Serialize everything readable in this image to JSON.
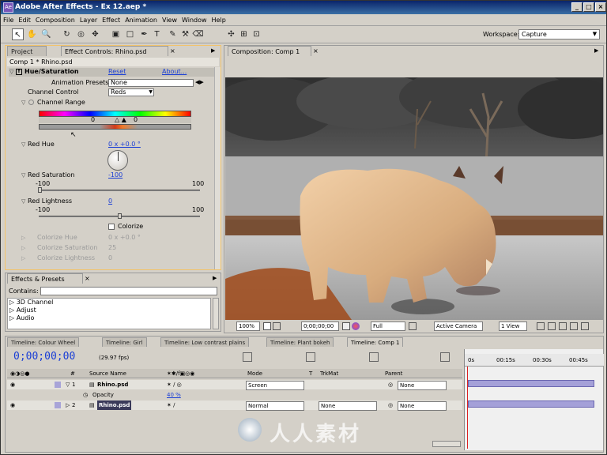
{
  "app": {
    "title": "Adobe After Effects - Ex 12.aep *",
    "icon_label": "Ae"
  },
  "window_controls": [
    "_",
    "□",
    "×"
  ],
  "menu": [
    "File",
    "Edit",
    "Composition",
    "Layer",
    "Effect",
    "Animation",
    "View",
    "Window",
    "Help"
  ],
  "tools": [
    "selection-tool",
    "hand-tool",
    "zoom-tool",
    "rotation-tool",
    "orbit-camera-tool",
    "track-xy-tool",
    "track-z-tool",
    "rectangle-mask-tool",
    "pen-tool",
    "type-tool",
    "brush-tool",
    "clone-stamp-tool",
    "eraser-tool",
    "axis-mode-local",
    "axis-mode-world",
    "axis-mode-view"
  ],
  "workspace": {
    "label": "Workspace:",
    "value": "Capture"
  },
  "left_panel": {
    "tabs": [
      "Project",
      "Effect Controls: Rhino.psd"
    ],
    "header": "Comp 1 * Rhino.psd",
    "effect": {
      "name": "Hue/Saturation",
      "reset": "Reset",
      "about": "About...",
      "presets_label": "Animation Presets:",
      "presets_value": "None",
      "channel_control_label": "Channel Control",
      "channel_control_value": "Reds",
      "channel_range_label": "Channel Range",
      "range_value": "0",
      "range_value2": "0",
      "red_hue_label": "Red Hue",
      "red_hue_value": "0 x +0.0 °",
      "red_saturation_label": "Red Saturation",
      "red_saturation_value": "-100",
      "sat_min": "-100",
      "sat_max": "100",
      "red_lightness_label": "Red Lightness",
      "red_lightness_value": "0",
      "light_min": "-100",
      "light_max": "100",
      "colorize_label": "Colorize",
      "colorize_hue_label": "Colorize Hue",
      "colorize_hue_value": "0 x +0.0 °",
      "colorize_saturation_label": "Colorize Saturation",
      "colorize_saturation_value": "25",
      "colorize_lightness_label": "Colorize Lightness",
      "colorize_lightness_value": "0"
    }
  },
  "effects_panel": {
    "tab": "Effects & Presets",
    "contains_label": "Contains:",
    "items": [
      "3D Channel",
      "Adjust",
      "Audio"
    ]
  },
  "comp_panel": {
    "tab": "Composition: Comp 1",
    "zoom": "100%",
    "timecode": "0;00;00;00",
    "resolution": "Full",
    "camera": "Active Camera",
    "views": "1 View"
  },
  "timeline": {
    "tabs": [
      "Timeline: Colour Wheel",
      "Timeline: Girl",
      "Timeline: Low contrast plains",
      "Timeline: Plant bokeh",
      "Timeline: Comp 1"
    ],
    "timecode": "0;00;00;00",
    "fps": "(29.97 fps)",
    "columns": {
      "num": "#",
      "source": "Source Name",
      "mode": "Mode",
      "t": "T",
      "trkmat": "TrkMat",
      "parent": "Parent"
    },
    "ruler": [
      "0s",
      "00:15s",
      "00:30s",
      "00:45s"
    ],
    "layers": [
      {
        "num": "1",
        "name": "Rhino.psd",
        "mode": "Screen",
        "trkmat": "",
        "parent": "None"
      },
      {
        "num": "2",
        "name": "Rhino.psd",
        "mode": "Normal",
        "trkmat": "None",
        "parent": "None"
      }
    ],
    "property": {
      "name": "Opacity",
      "value": "40 %"
    }
  },
  "watermark": "人人素材"
}
